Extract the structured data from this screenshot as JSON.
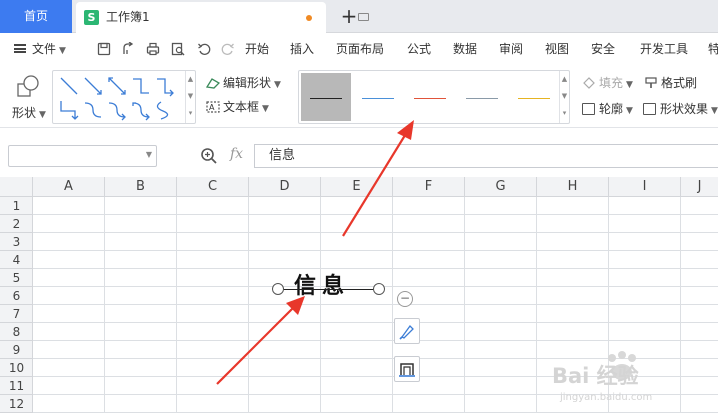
{
  "tabs": {
    "home_label": "首页",
    "doc_label": "工作簿1",
    "doc_icon_letter": "S"
  },
  "menu": {
    "file_label": "文件",
    "items": [
      "开始",
      "插入",
      "页面布局",
      "公式",
      "数据",
      "审阅",
      "视图",
      "安全",
      "开发工具",
      "特"
    ]
  },
  "ribbon": {
    "shape_label": "形状",
    "edit_shape_label": "编辑形状",
    "textbox_label": "文本框",
    "fill_label": "填充",
    "format_painter_label": "格式刷",
    "outline_label": "轮廓",
    "shape_effect_label": "形状效果",
    "line_styles": [
      {
        "color": "#222222",
        "selected": true
      },
      {
        "color": "#4a90d9",
        "selected": false
      },
      {
        "color": "#e0543a",
        "selected": false
      },
      {
        "color": "#8a9aa8",
        "selected": false
      },
      {
        "color": "#e6b422",
        "selected": false
      }
    ]
  },
  "formula_bar": {
    "name_box_value": "",
    "fx_label": "fx",
    "content": "信息"
  },
  "grid": {
    "columns": [
      "A",
      "B",
      "C",
      "D",
      "E",
      "F",
      "G",
      "H",
      "I",
      "J"
    ],
    "rows": [
      "1",
      "2",
      "3",
      "4",
      "5",
      "6",
      "7",
      "8",
      "9",
      "10",
      "11",
      "12"
    ]
  },
  "shape": {
    "text": "信息"
  },
  "watermark": {
    "brand": "Bai 经验",
    "url": "jingyan.baidu.com"
  },
  "colors": {
    "home_tab": "#3d7bf0",
    "doc_icon": "#2bb673",
    "annotation_arrow": "#e8372b"
  }
}
